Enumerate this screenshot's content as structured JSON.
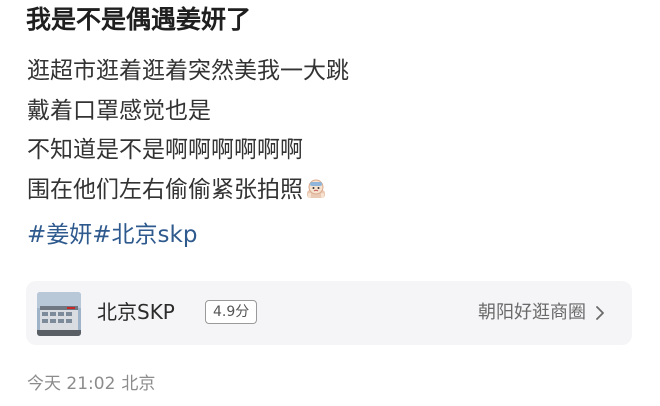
{
  "post": {
    "title": "我是不是偶遇姜妍了",
    "lines": [
      "逛超市逛着逛着突然美我一大跳",
      "戴着口罩感觉也是",
      "不知道是不是啊啊啊啊啊啊",
      "围在他们左右偷偷紧张拍照"
    ],
    "emoji_icon": "nervous-face-emoji-icon",
    "tags": [
      "#姜妍",
      "#北京skp"
    ]
  },
  "place": {
    "name": "北京SKP",
    "rating": "4.9分",
    "district": "朝阳好逛商圈",
    "chevron_icon": "chevron-right-icon"
  },
  "meta": {
    "time": "今天 21:02",
    "location": "北京"
  },
  "colors": {
    "tag": "#2f5a8e",
    "card_bg": "#f5f5f7",
    "meta": "#8c8c8c"
  }
}
